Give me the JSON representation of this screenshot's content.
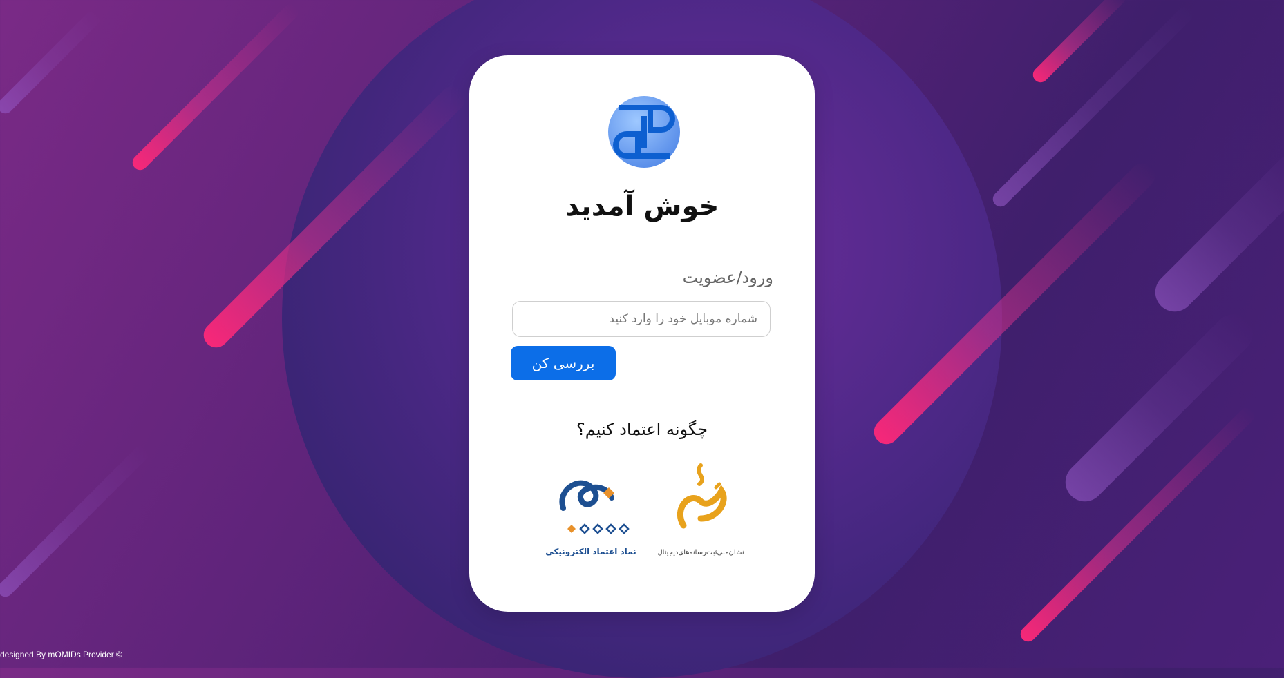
{
  "login": {
    "welcome_title": "خوش آمدید",
    "field_label": "ورود/عضویت",
    "phone_placeholder": "شماره موبایل خود را وارد کنید",
    "submit_label": "بررسی کن"
  },
  "trust": {
    "heading": "چگونه اعتماد کنیم؟",
    "badges": [
      {
        "name": "enamad-icon",
        "caption": "نماد اعتماد الکترونیکی"
      },
      {
        "name": "samandehi-icon",
        "caption": "نشان‌ملی‌ثبت‌رسانه‌های‌دیجیتال"
      }
    ]
  },
  "footer": {
    "credit": "designed By mOMIDs Provider ©"
  },
  "colors": {
    "primary_button": "#0c6ee8",
    "card_background": "#ffffff",
    "accent_pink": "#ff2878",
    "background_purple": "#5b2379"
  },
  "icons": {
    "logo": "brand-logo-icon"
  }
}
